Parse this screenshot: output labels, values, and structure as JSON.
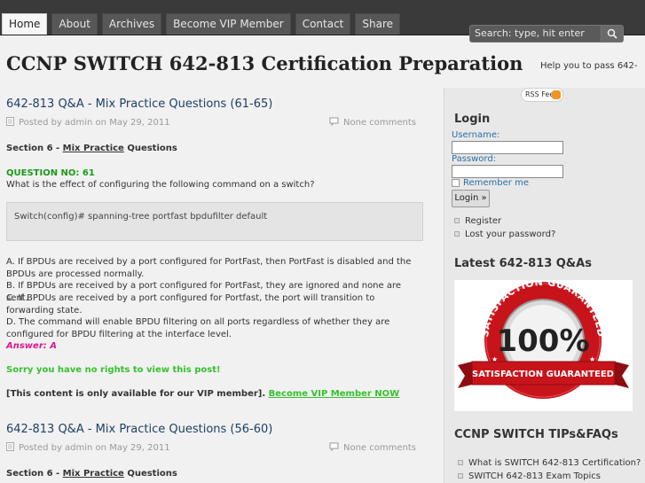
{
  "nav": {
    "tabs": [
      {
        "label": "Home"
      },
      {
        "label": "About"
      },
      {
        "label": "Archives"
      },
      {
        "label": "Become VIP Member"
      },
      {
        "label": "Contact"
      },
      {
        "label": "Share"
      }
    ]
  },
  "search": {
    "placeholder": "Search: type, hit enter"
  },
  "site": {
    "title": "CCNP SWITCH 642-813 Certification Preparation",
    "tagline": "Help you to pass 642-"
  },
  "posts": [
    {
      "title": "642-813 Q&A - Mix Practice Questions (61-65)",
      "meta": "Posted by admin on May 29, 2011",
      "comments": "None comments",
      "section_prefix": "Section 6 - ",
      "section_link": "Mix Practice",
      "section_suffix": " Questions",
      "question_no": "QUESTION NO: 61",
      "question": "What is the effect of configuring the following command on a switch?",
      "code": "Switch(config)# spanning-tree portfast bpdufilter default",
      "options": [
        "A. If BPDUs are received by a port configured for PortFast, then PortFast is disabled and the BPDUs are processed normally.",
        "B. If BPDUs are received by a port configured for PortFast, they are ignored and none are sent.",
        "C. If BPDUs are received by a port configured for Portfast, the port will transition to forwarding state.",
        "D. The command will enable BPDU filtering on all ports regardless of whether they are configured for BPDU filtering at the interface level."
      ],
      "answer": "Answer: A",
      "sorry": "Sorry you have no rights to view this post!",
      "vip_text": "[This content is only available for our VIP member]. ",
      "vip_link": "Become VIP Member NOW"
    },
    {
      "title": "642-813 Q&A - Mix Practice Questions (56-60)",
      "meta": "Posted by admin on May 29, 2011",
      "comments": "None comments",
      "section_prefix": "Section 6 - ",
      "section_link": "Mix Practice",
      "section_suffix": " Questions"
    }
  ],
  "sidebar": {
    "rss_label": "RSS Feed",
    "login": {
      "title": "Login",
      "username_label": "Username:",
      "password_label": "Password:",
      "remember_label": "Remember me",
      "button_label": "Login »",
      "links": [
        "Register",
        "Lost your password?"
      ]
    },
    "latest_title": "Latest 642-813 Q&As",
    "badge": {
      "top_text": "SATISFACTION GUARANTEED",
      "number": "100%",
      "ribbon_text": "SATISFACTION GUARANTEED"
    },
    "tips_title": "CCNP SWITCH TIPs&FAQs",
    "tips_links": [
      "What is SWITCH 642-813 Certification?",
      "SWITCH 642-813 Exam Topics"
    ]
  },
  "colors": {
    "topbar": "#3a3a3a",
    "title_blue": "#1f3f66",
    "green": "#37c22d",
    "answer_pink": "#e0148c",
    "badge_red": "#c7141b",
    "badge_silver": "#d9d9d9"
  }
}
